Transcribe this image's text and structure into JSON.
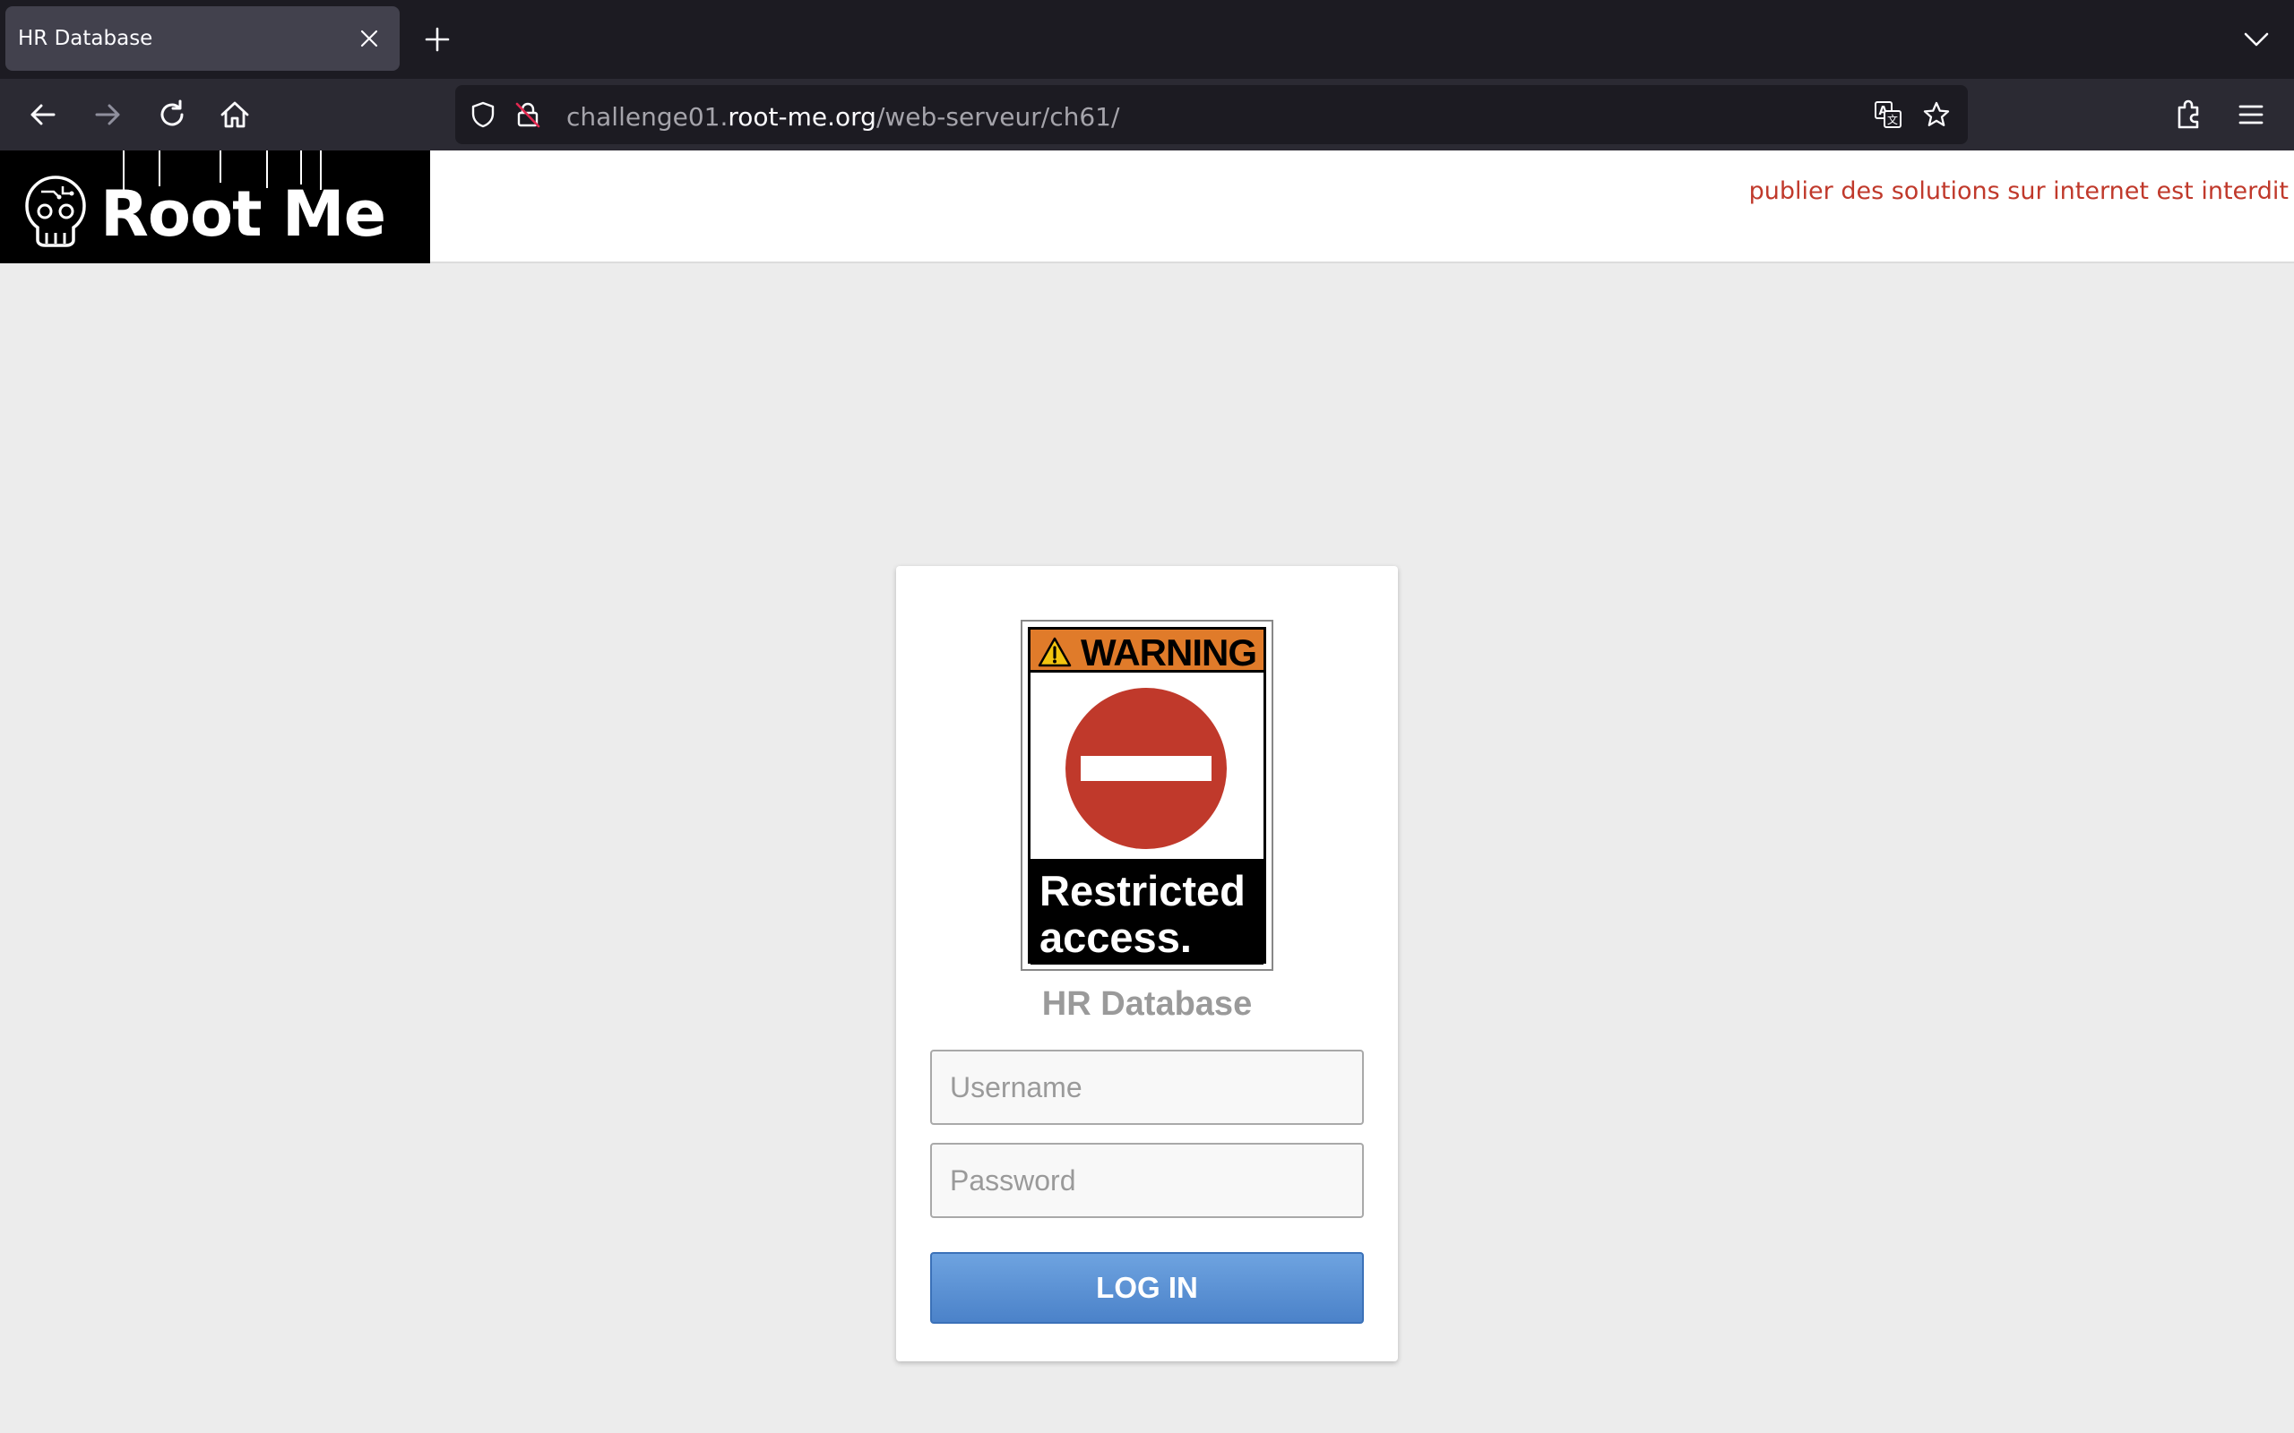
{
  "browser": {
    "tab": {
      "title": "HR Database"
    },
    "url": {
      "prefix": "challenge01.",
      "host": "root-me.org",
      "path": "/web-serveur/ch61/"
    },
    "icons": [
      "close-icon",
      "plus-icon",
      "chevron-down-icon",
      "back-arrow-icon",
      "forward-arrow-icon",
      "reload-icon",
      "home-icon",
      "shield-icon",
      "insecure-lock-icon",
      "translate-icon",
      "star-icon",
      "extensions-icon",
      "hamburger-menu-icon"
    ]
  },
  "header": {
    "logo_text": "Root Me",
    "notice": "publier des solutions sur internet est interdit"
  },
  "login": {
    "sign": {
      "warning": "WARNING",
      "line1": "Restricted",
      "line2": "access."
    },
    "title": "HR Database",
    "username_placeholder": "Username",
    "password_placeholder": "Password",
    "button": "LOG IN"
  },
  "colors": {
    "chrome_dark": "#1c1b22",
    "toolbar": "#2b2a33",
    "page_bg": "#ececec",
    "notice_red": "#c0392b",
    "button_blue": "#4b82c9",
    "sign_orange": "#e07b2a",
    "sign_red": "#c0392b"
  }
}
